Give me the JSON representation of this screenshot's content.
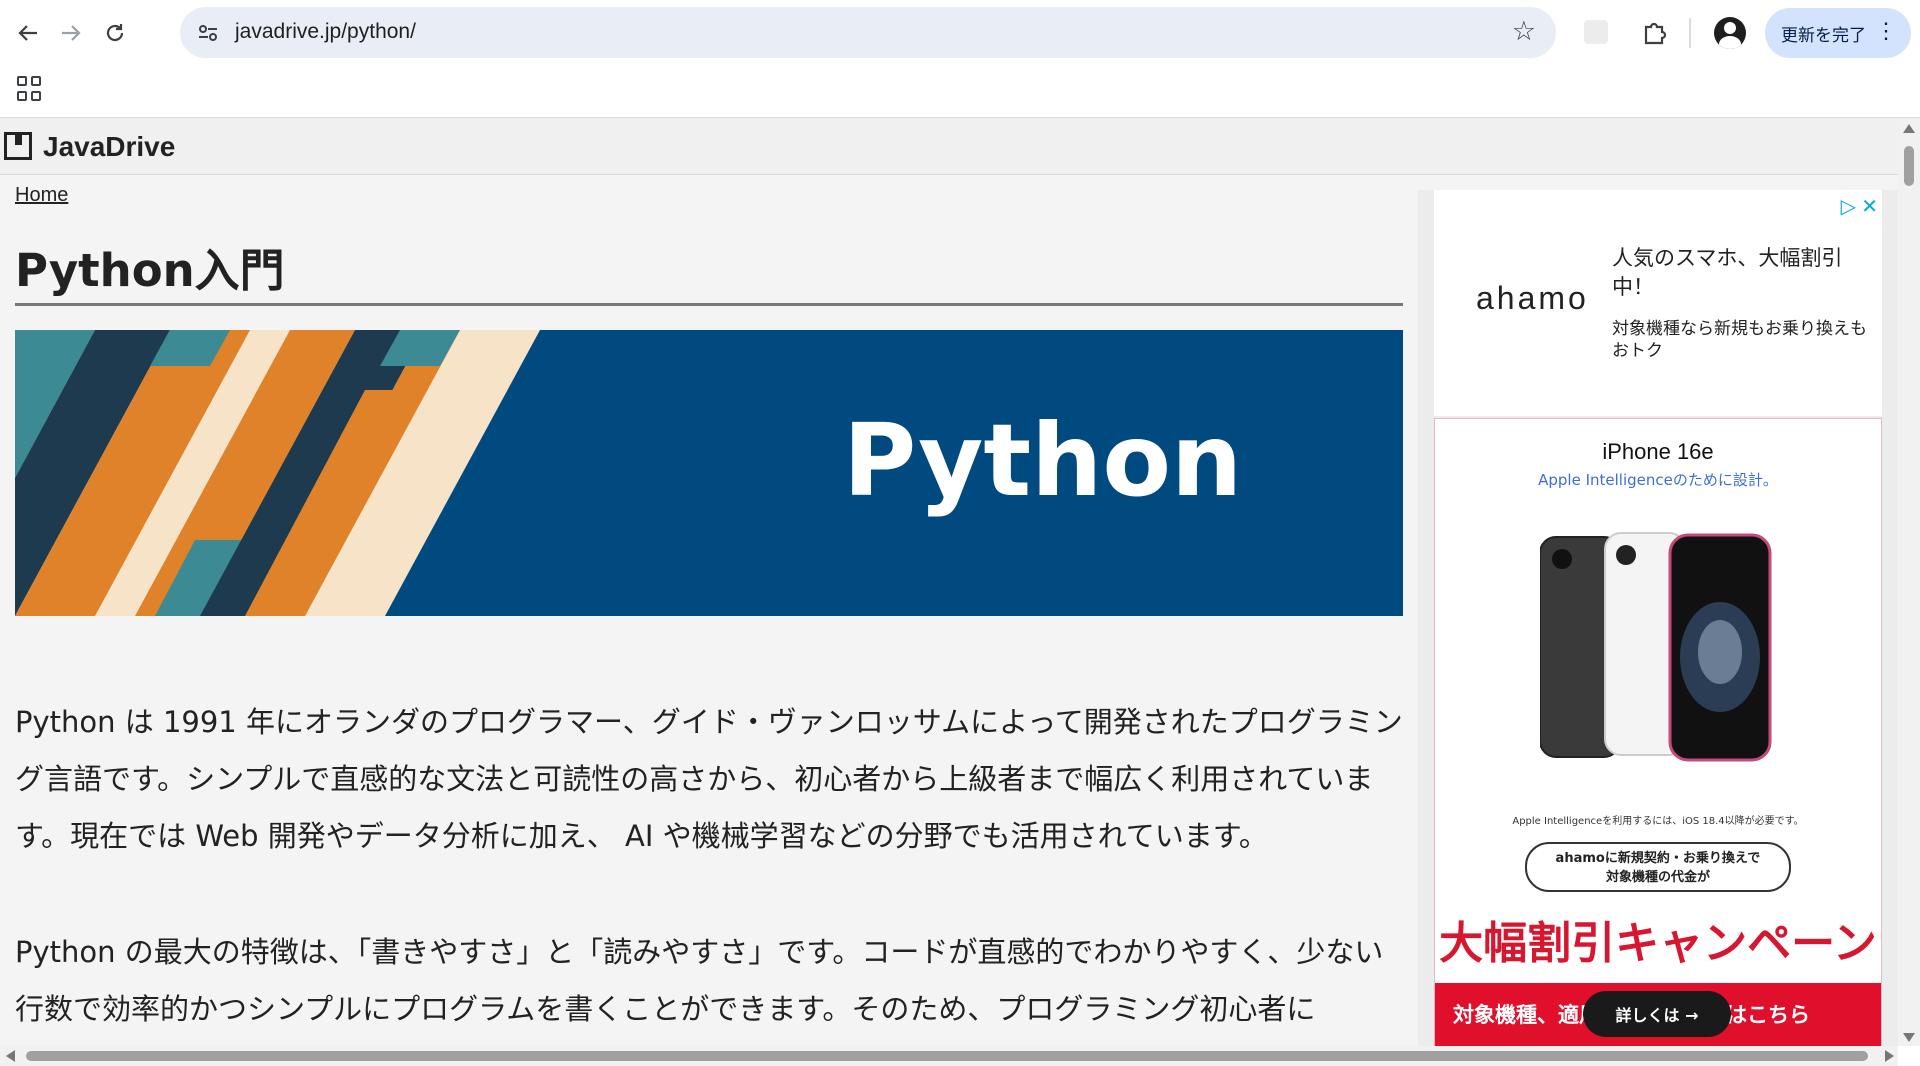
{
  "browser": {
    "url": "javadrive.jp/python/",
    "update_button_label": "更新を完了",
    "back_icon": "arrow-left-icon",
    "forward_icon": "arrow-right-icon",
    "reload_icon": "reload-icon",
    "site_settings_icon": "tune-icon",
    "bookmark_icon": "star-icon",
    "extensions_icon": "puzzle-icon",
    "profile_icon": "account-circle-icon",
    "menu_icon": "kebab-menu-icon",
    "apps_icon": "apps-grid-icon"
  },
  "site": {
    "logo": "JavaDrive",
    "breadcrumb": "Home"
  },
  "main": {
    "title": "Python入門",
    "banner_text": "Python",
    "paragraphs": [
      "Python は 1991 年にオランダのプログラマー、グイド・ヴァンロッサムによって開発されたプログラミング言語です。シンプルで直感的な文法と可読性の高さから、初心者から上級者まで幅広く利用されています。現在では Web 開発やデータ分析に加え、 AI や機械学習などの分野でも活用されています。",
      "Python の最大の特徴は、「書きやすさ」と「読みやすさ」です。コードが直感的でわかりやすく、少ない行数で効率的かつシンプルにプログラムを書くことができます。そのため、プログラミング初心者に"
    ]
  },
  "ads": {
    "ad1": {
      "brand": "ahamo",
      "title": "人気のスマホ、大幅割引中！",
      "description": "対象機種なら新規もお乗り換えもおトク"
    },
    "ad2": {
      "product": "iPhone 16e",
      "tagline": "Apple Intelligenceのために設計。",
      "note": "Apple Intelligenceを利用するには、iOS 18.4以降が必要です。",
      "bubble": "ahamoに新規契約・お乗り換えで\n対象機種の代金が",
      "campaign": "大幅割引キャンペーン",
      "footer": "対象機種、適用条件の詳しくはこちら",
      "button": "詳しくは →"
    }
  },
  "colors": {
    "banner_bg": "#014a80",
    "stripe_orange": "#e0822a",
    "stripe_navy": "#1e3a4f",
    "stripe_teal": "#3c8a93",
    "stripe_cream": "#f7e3c8",
    "campaign_red": "#d7172f"
  }
}
